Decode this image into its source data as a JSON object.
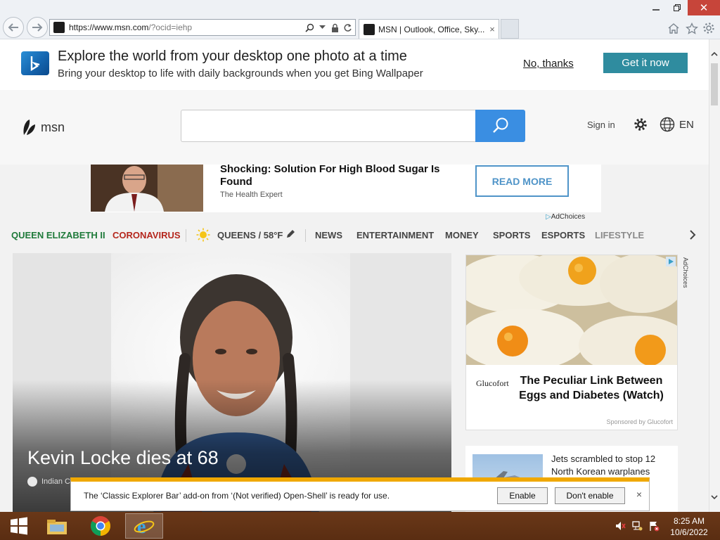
{
  "browser": {
    "address": "https://www.msn.com/?ocid=iehp",
    "address_host": "https://www.msn.com",
    "address_path": "/?ocid=iehp",
    "tab_title": "MSN | Outlook, Office, Skype, ...",
    "tab_title_shown": "MSN | Outlook, Office, Sky...",
    "tab_close": "×",
    "close_glyph": "✕"
  },
  "banner": {
    "title": "Explore the world from your desktop one photo at a time",
    "subtitle": "Bring your desktop to life with daily backgrounds when you get Bing Wallpaper",
    "no_thanks": "No, thanks",
    "get_it": "Get it now"
  },
  "header": {
    "logo_text": "msn",
    "search_placeholder": "",
    "sign_in": "Sign in",
    "language": "EN"
  },
  "top_ad": {
    "headline": "Shocking: Solution For High Blood Sugar Is Found",
    "source": "The Health Expert",
    "cta": "READ MORE",
    "adchoices": "AdChoices"
  },
  "nav": {
    "items": [
      {
        "label": "QUEEN ELIZABETH II",
        "color": "#1e7a3a"
      },
      {
        "label": "CORONAVIRUS",
        "color": "#b5271d"
      },
      {
        "label": "QUEENS / 58°F",
        "color": "#444444"
      },
      {
        "label": "NEWS",
        "color": "#444444"
      },
      {
        "label": "ENTERTAINMENT",
        "color": "#444444"
      },
      {
        "label": "MONEY",
        "color": "#444444"
      },
      {
        "label": "SPORTS",
        "color": "#444444"
      },
      {
        "label": "ESPORTS",
        "color": "#444444"
      },
      {
        "label": "LIFESTYLE",
        "color": "#8a8a8a"
      }
    ]
  },
  "hero": {
    "title": "Kevin Locke dies at 68",
    "source": "Indian C"
  },
  "right_ad": {
    "brand": "Glucofort",
    "headline": "The Peculiar Link Between Eggs and Diabetes (Watch)",
    "sponsor": "Sponsored by Glucofort",
    "adchoices": "AdChoices"
  },
  "news_card": {
    "headline": "Jets scrambled to stop 12 North Korean warplanes"
  },
  "notification": {
    "text": "The ‘Classic Explorer Bar’ add-on from ‘(Not verified) Open-Shell’ is ready for use.",
    "enable": "Enable",
    "dont_enable": "Don't enable",
    "close": "×"
  },
  "taskbar": {
    "time": "8:25 AM",
    "date": "10/6/2022"
  },
  "colors": {
    "accent_blue": "#3a8ee2",
    "bing_teal": "#2f8c9f",
    "notif_yellow": "#f0a800",
    "taskbar_brown": "#5a2d12"
  }
}
